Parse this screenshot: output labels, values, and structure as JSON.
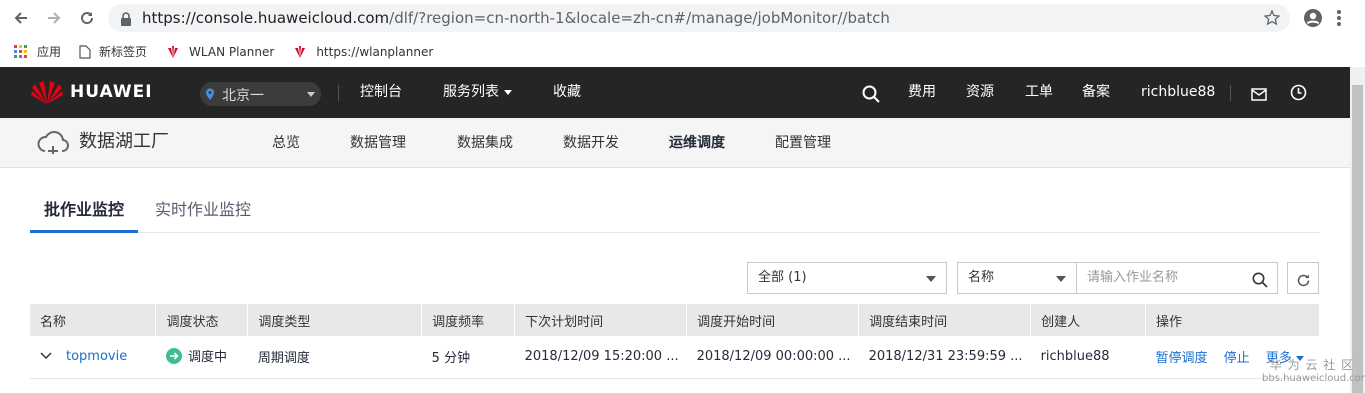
{
  "browser": {
    "url_host": "https://console.huaweicloud.com",
    "url_path": "/dlf/?region=cn-north-1&locale=zh-cn#/manage/jobMonitor//batch"
  },
  "bookmarks": [
    {
      "label": "应用"
    },
    {
      "label": "新标签页"
    },
    {
      "label": "WLAN Planner"
    },
    {
      "label": "https://wlanplanner"
    }
  ],
  "topnav": {
    "brand": "HUAWEI",
    "region": "北京一",
    "console": "控制台",
    "services": "服务列表",
    "favorites": "收藏",
    "fees": "费用",
    "resources": "资源",
    "tickets": "工单",
    "filing": "备案",
    "username": "richblue88"
  },
  "subnav": {
    "product": "数据湖工厂",
    "items": [
      "总览",
      "数据管理",
      "数据集成",
      "数据开发",
      "运维调度",
      "配置管理"
    ],
    "active": "运维调度"
  },
  "tabs": [
    {
      "label": "批作业监控",
      "active": true
    },
    {
      "label": "实时作业监控",
      "active": false
    }
  ],
  "filters": {
    "scope": "全部 (1)",
    "field": "名称",
    "search_placeholder": "请输入作业名称"
  },
  "table": {
    "headers": [
      "名称",
      "调度状态",
      "调度类型",
      "调度频率",
      "下次计划时间",
      "调度开始时间",
      "调度结束时间",
      "创建人",
      "操作"
    ],
    "rows": [
      {
        "name": "topmovie",
        "status": "调度中",
        "type": "周期调度",
        "frequency": "5 分钟",
        "next_time": "2018/12/09 15:20:00 ...",
        "start_time": "2018/12/09 00:00:00 ...",
        "end_time": "2018/12/31 23:59:59 ...",
        "creator": "richblue88",
        "actions": {
          "pause": "暂停调度",
          "stop": "停止",
          "more": "更多"
        }
      }
    ]
  },
  "watermark": {
    "line1": "华 为 云 社 区",
    "line2": "bbs.huaweicloud.com"
  }
}
